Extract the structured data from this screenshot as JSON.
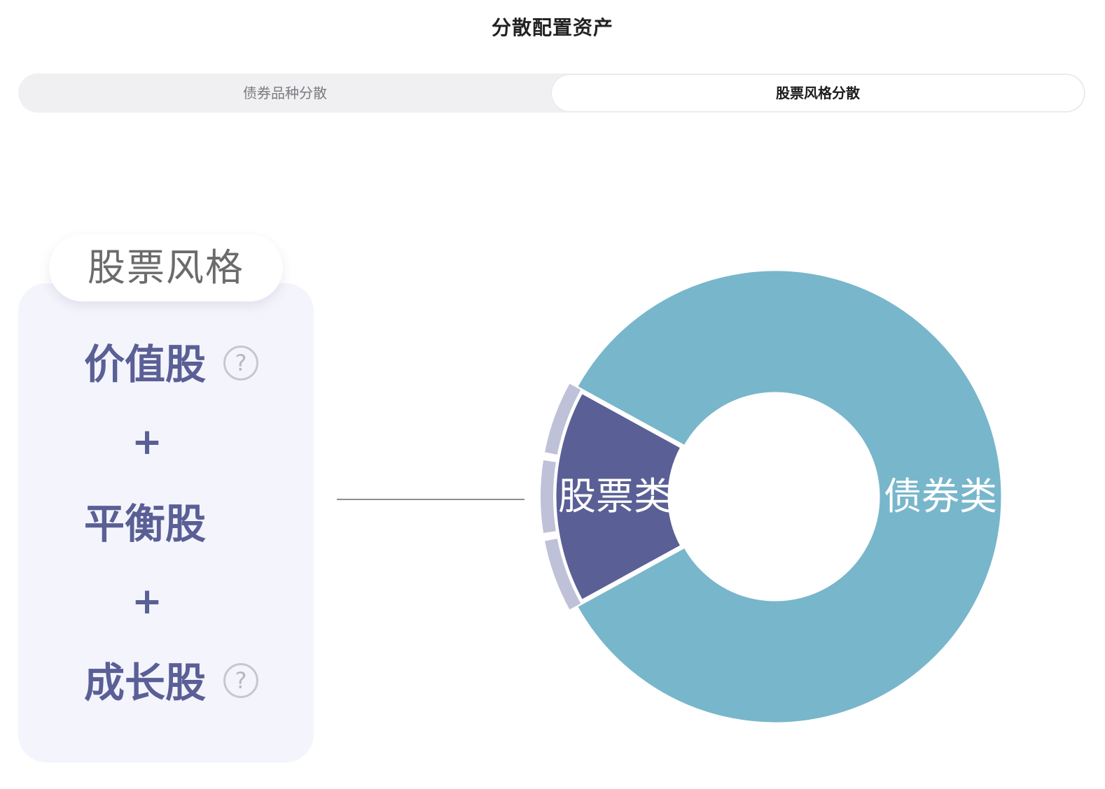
{
  "page": {
    "title": "分散配置资产"
  },
  "tabs": [
    {
      "label": "债券品种分散",
      "active": false
    },
    {
      "label": "股票风格分散",
      "active": true
    }
  ],
  "style_card": {
    "header": "股票风格",
    "items": [
      {
        "label": "价值股",
        "has_help": true
      },
      {
        "label": "平衡股",
        "has_help": false
      },
      {
        "label": "成长股",
        "has_help": true
      }
    ],
    "separator": "+",
    "help_glyph": "?"
  },
  "colors": {
    "stock": "#5a5f95",
    "bond": "#78b6cb",
    "stock_sub_arc": "#bfc1d9"
  },
  "icons": {
    "help": "question-circle-icon"
  },
  "chart_data": {
    "type": "pie",
    "donut": true,
    "slices": [
      {
        "label": "股票类",
        "value": 16,
        "color": "#5a5f95"
      },
      {
        "label": "债券类",
        "value": 84,
        "color": "#78b6cb"
      }
    ],
    "sub_arcs_on_slice": "股票类",
    "sub_arc_count": 3
  }
}
